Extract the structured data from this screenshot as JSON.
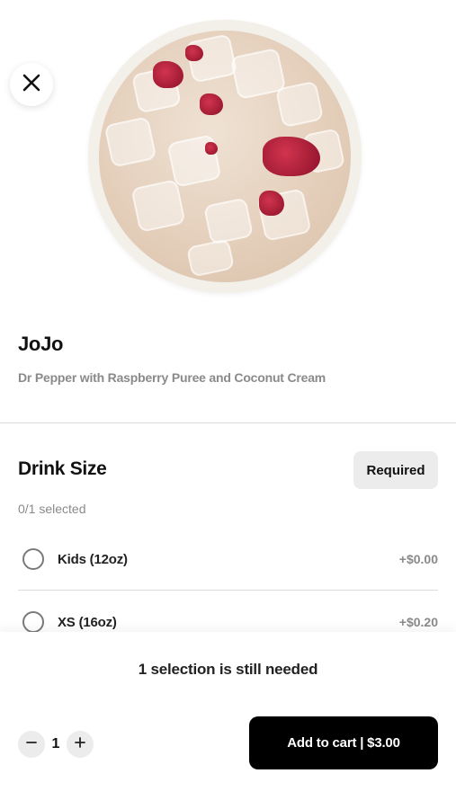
{
  "product": {
    "name": "JoJo",
    "description": "Dr Pepper with Raspberry Puree and Coconut Cream"
  },
  "icons": {
    "close": "close-icon",
    "minus": "minus-icon",
    "plus": "plus-icon"
  },
  "drink_size": {
    "title": "Drink Size",
    "badge": "Required",
    "selected_count": "0/1 selected",
    "options": [
      {
        "label": "Kids (12oz)",
        "price": "+$0.00",
        "selected": false
      },
      {
        "label": "XS (16oz)",
        "price": "+$0.20",
        "selected": false
      }
    ]
  },
  "footer": {
    "notice": "1 selection is still needed",
    "quantity": "1",
    "add_to_cart_label": "Add to cart | $3.00"
  },
  "colors": {
    "accent": "#000000",
    "muted_text": "#8a8a8a",
    "badge_bg": "#ececec"
  }
}
